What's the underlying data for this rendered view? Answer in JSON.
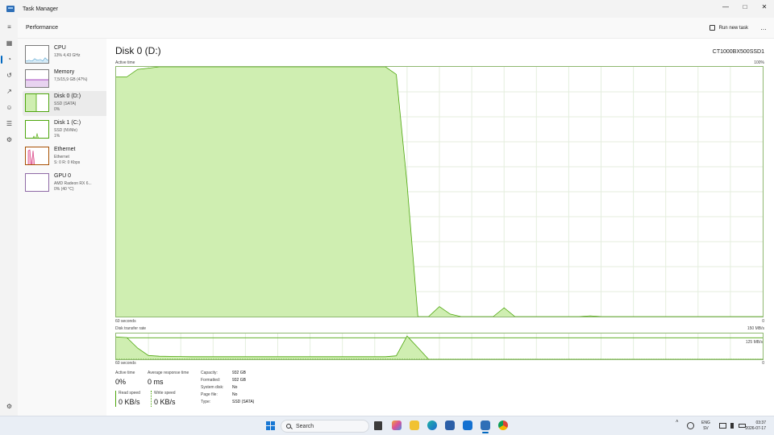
{
  "window": {
    "title": "Task Manager",
    "controls": {
      "minimize": "—",
      "maximize": "□",
      "close": "✕"
    }
  },
  "header": {
    "title": "Performance",
    "run_new_task": "Run new task",
    "more": "…"
  },
  "rail": [
    {
      "icon": "hamburger-menu-icon",
      "glyph": "≡"
    },
    {
      "icon": "processes-icon",
      "glyph": "▦"
    },
    {
      "icon": "performance-icon",
      "glyph": "◔"
    },
    {
      "icon": "app-history-icon",
      "glyph": "↺"
    },
    {
      "icon": "startup-apps-icon",
      "glyph": "↗"
    },
    {
      "icon": "users-icon",
      "glyph": "☺"
    },
    {
      "icon": "details-icon",
      "glyph": "☰"
    },
    {
      "icon": "services-icon",
      "glyph": "⚙"
    }
  ],
  "settings_glyph": "⚙",
  "devices": [
    {
      "name": "CPU",
      "sub1": "13% 4,43 GHz",
      "sub2": "",
      "color": "#117dbb"
    },
    {
      "name": "Memory",
      "sub1": "7,5/15,9 GB (47%)",
      "sub2": "",
      "color": "#8b12ae"
    },
    {
      "name": "Disk 0 (D:)",
      "sub1": "SSD (SATA)",
      "sub2": "0%",
      "color": "#4da60c"
    },
    {
      "name": "Disk 1 (C:)",
      "sub1": "SSD (NVMe)",
      "sub2": "1%",
      "color": "#4da60c"
    },
    {
      "name": "Ethernet",
      "sub1": "Ethernet",
      "sub2": "S: 0 R: 0 Kbps",
      "color": "#a74f01"
    },
    {
      "name": "GPU 0",
      "sub1": "AMD Radeon RX 6...",
      "sub2": "0% (40 °C)",
      "color": "#b36fd0"
    }
  ],
  "disk": {
    "title": "Disk 0 (D:)",
    "model": "CT1000BX500SSD1",
    "active_time_label": "Active time",
    "active_time_max": "100%",
    "axis_left": "60 seconds",
    "axis_right": "0",
    "transfer_label": "Disk transfer rate",
    "transfer_max": "150 MB/s",
    "transfer_ref": "125 MB/s",
    "colors": {
      "line": "#4da60c",
      "fill": "#cfeeb1",
      "grid": "#e4eede",
      "border": "#8fb870"
    }
  },
  "stats": {
    "active_time": {
      "label": "Active time",
      "value": "0%"
    },
    "response": {
      "label": "Average response time",
      "value": "0 ms"
    },
    "read": {
      "label": "Read speed",
      "value": "0 KB/s"
    },
    "write": {
      "label": "Write speed",
      "value": "0 KB/s"
    },
    "props": [
      {
        "key": "Capacity:",
        "value": "932 GB"
      },
      {
        "key": "Formatted:",
        "value": "932 GB"
      },
      {
        "key": "System disk:",
        "value": "No"
      },
      {
        "key": "Page file:",
        "value": "No"
      },
      {
        "key": "Type:",
        "value": "SSD (SATA)"
      }
    ]
  },
  "chart_data": [
    {
      "type": "area",
      "title": "Active time",
      "xlabel": "60 seconds",
      "x": [
        60,
        59,
        58,
        57,
        56,
        55,
        54,
        53,
        52,
        51,
        50,
        49,
        48,
        47,
        46,
        45,
        44,
        43,
        42,
        41,
        40,
        39,
        38,
        37,
        36,
        35,
        34,
        33,
        32,
        31,
        30,
        29,
        28,
        27,
        26,
        25,
        24,
        23,
        22,
        21,
        20,
        19,
        18,
        17,
        16,
        15,
        14,
        13,
        12,
        11,
        10,
        9,
        8,
        7,
        6,
        5,
        4,
        3,
        2,
        1,
        0
      ],
      "series": [
        {
          "values": [
            96,
            96,
            99,
            99.5,
            100,
            100,
            100,
            100,
            100,
            100,
            100,
            100,
            100,
            100,
            100,
            100,
            100,
            100,
            100,
            100,
            100,
            100,
            100,
            100,
            100,
            100,
            97,
            53,
            0,
            0,
            4,
            1,
            0,
            0,
            0,
            0,
            3.5,
            0,
            0,
            0,
            0,
            0,
            0,
            0,
            0.3,
            0,
            0,
            0,
            0,
            0,
            0,
            0,
            0,
            0,
            0,
            0,
            0,
            0,
            0,
            0,
            0
          ]
        }
      ],
      "ylim": [
        0,
        100
      ],
      "yaxis_max_label": "100%",
      "grid": true
    },
    {
      "type": "area",
      "title": "Disk transfer rate",
      "xlabel": "60 seconds",
      "x": [
        60,
        59,
        58,
        57,
        56,
        55,
        54,
        53,
        52,
        51,
        50,
        49,
        48,
        47,
        46,
        45,
        44,
        43,
        42,
        41,
        40,
        39,
        38,
        37,
        36,
        35,
        34,
        33,
        32,
        31,
        30,
        29,
        28,
        27,
        26,
        25,
        24,
        23,
        22,
        21,
        20,
        19,
        18,
        17,
        16,
        15,
        14,
        13,
        12,
        11,
        10,
        9,
        8,
        7,
        6,
        5,
        4,
        3,
        2,
        1,
        0
      ],
      "series": [
        {
          "name": "Read speed",
          "values": [
            130,
            126,
            65,
            22,
            18,
            17,
            16,
            15,
            15,
            15,
            15,
            15,
            15,
            15,
            15,
            15,
            15,
            15,
            15,
            15,
            15,
            15,
            15,
            15,
            15,
            15,
            20,
            135,
            68,
            0,
            0,
            0,
            0,
            0,
            0,
            0,
            0,
            0,
            0,
            0,
            0,
            0,
            0,
            0,
            0,
            0,
            0,
            0,
            0,
            0,
            0,
            0,
            0,
            0,
            0,
            0,
            0,
            0,
            0,
            0,
            0
          ]
        },
        {
          "name": "Write speed",
          "values": [
            0,
            0,
            0,
            0,
            0,
            0,
            0,
            0,
            0,
            0,
            0,
            0,
            0,
            0,
            0,
            0,
            0,
            0,
            0,
            0,
            0,
            0,
            0,
            0,
            0,
            0,
            0,
            0,
            0,
            0,
            0,
            0,
            0,
            0,
            0,
            0,
            0,
            0,
            0,
            0,
            0,
            0,
            0,
            0,
            0,
            0,
            0,
            0,
            0,
            0,
            0,
            0,
            0,
            0,
            0,
            0,
            0,
            0,
            0,
            0,
            0
          ]
        }
      ],
      "reference_line": 125,
      "ylim": [
        0,
        150
      ],
      "yaxis_max_label": "150 MB/s",
      "grid": true
    }
  ],
  "taskbar": {
    "search": "Search",
    "lang_top": "ENG",
    "lang_bottom": "SV",
    "time": "03:37",
    "date": "2026-07-17",
    "tray_chevron": "˄"
  }
}
